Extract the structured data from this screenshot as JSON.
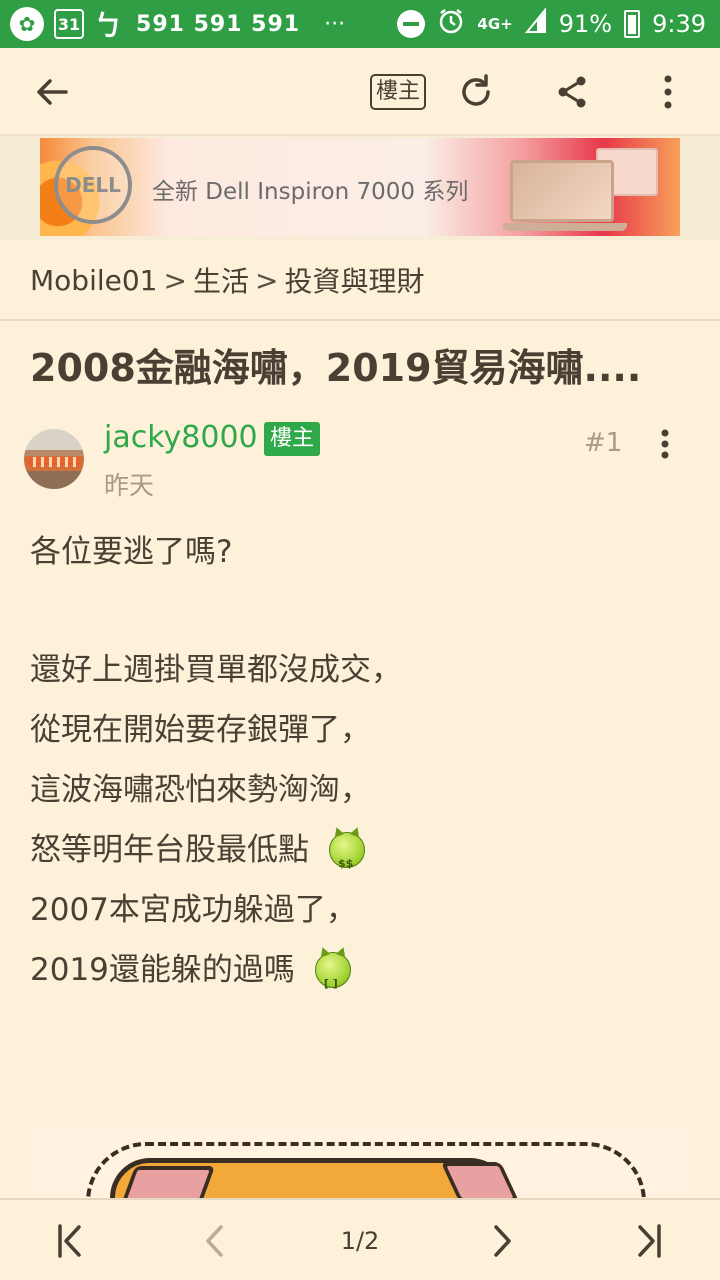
{
  "status_bar": {
    "calendar_day": "31",
    "numbers": "591 591 591",
    "overflow": "···",
    "network": "4G+",
    "battery": "91%",
    "time": "9:39",
    "icons": [
      "leaf-app-icon",
      "calendar-icon",
      "app-icon",
      "dnd-icon",
      "alarm-icon",
      "signal-icon",
      "battery-icon"
    ]
  },
  "app_bar": {
    "op_only_label": "樓主",
    "icons": [
      "back-arrow-icon",
      "refresh-icon",
      "share-icon",
      "more-vert-icon"
    ]
  },
  "ad": {
    "brand": "DELL",
    "text": "全新 Dell Inspiron 7000 系列"
  },
  "breadcrumb": {
    "items": [
      "Mobile01",
      "生活",
      "投資與理財"
    ],
    "separator": ">"
  },
  "post": {
    "title": "2008金融海嘯，2019貿易海嘯....",
    "author": "jacky8000",
    "op_badge": "樓主",
    "time": "昨天",
    "floor": "#1",
    "lines": [
      "各位要逃了嗎?",
      "",
      "還好上週掛買單都沒成交，",
      "從現在開始要存銀彈了，",
      "這波海嘯恐怕來勢洶洶，",
      "怒等明年台股最低點",
      "2007本宮成功躲過了，",
      "2019還能躲的過嗎"
    ],
    "emoji_faces": [
      "$$",
      "[ ]"
    ]
  },
  "pagination": {
    "current_page": "1/2"
  },
  "colors": {
    "status_bar": "#2f9e44",
    "background": "#fdf1da",
    "accent_green": "#2fa84a",
    "text": "#4a3f33",
    "muted": "#a89a85"
  }
}
